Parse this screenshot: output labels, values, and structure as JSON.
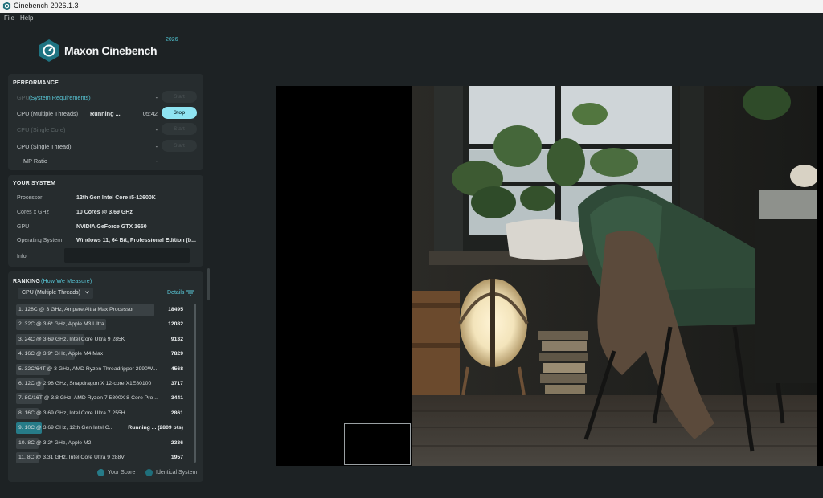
{
  "window": {
    "title": "Cinebench 2026.1.3"
  },
  "menu": {
    "file": "File",
    "help": "Help"
  },
  "logo": {
    "text": "Maxon Cinebench",
    "year": "2026"
  },
  "performance": {
    "title": "PERFORMANCE",
    "gpu": {
      "name": "GPU",
      "link": "(System Requirements)",
      "time": "-",
      "button": "Start"
    },
    "cpu_multi": {
      "name": "CPU (Multiple Threads)",
      "status": "Running ...",
      "time": "05:42",
      "button": "Stop"
    },
    "cpu_single_core": {
      "name": "CPU (Single Core)",
      "time": "-",
      "button": "Start"
    },
    "cpu_single_thread": {
      "name": "CPU (Single Thread)",
      "time": "-",
      "button": "Start"
    },
    "mp_ratio": {
      "name": "MP Ratio",
      "time": "-"
    }
  },
  "system": {
    "title": "YOUR SYSTEM",
    "rows": [
      {
        "label": "Processor",
        "value": "12th Gen Intel Core i5-12600K"
      },
      {
        "label": "Cores x GHz",
        "value": "10 Cores @ 3.69 GHz"
      },
      {
        "label": "GPU",
        "value": "NVIDIA GeForce GTX 1650"
      },
      {
        "label": "Operating System",
        "value": "Windows 11, 64 Bit, Professional Edition (b..."
      },
      {
        "label": "Info",
        "value": ""
      }
    ]
  },
  "ranking": {
    "title": "RANKING",
    "link": "(How We Measure)",
    "dropdown": "CPU (Multiple Threads)",
    "details": "Details",
    "max": 18495,
    "rows": [
      {
        "text": "1. 128C @ 3 GHz, Ampere Altra Max Processor",
        "score": "18495",
        "value": 18495
      },
      {
        "text": "2. 32C @ 3.6* GHz, Apple M3 Ultra",
        "score": "12082",
        "value": 12082
      },
      {
        "text": "3. 24C @ 3.69 GHz, Intel Core Ultra 9 285K",
        "score": "9132",
        "value": 9132
      },
      {
        "text": "4. 16C @ 3.9* GHz, Apple M4 Max",
        "score": "7829",
        "value": 7829
      },
      {
        "text": "5. 32C/64T @ 3 GHz, AMD Ryzen Threadripper 2990W...",
        "score": "4568",
        "value": 4568
      },
      {
        "text": "6. 12C @ 2.98 GHz, Snapdragon X 12-core X1E80100",
        "score": "3717",
        "value": 3717
      },
      {
        "text": "7. 8C/16T @ 3.8 GHz, AMD Ryzen 7 5800X 8-Core Pro...",
        "score": "3441",
        "value": 3441
      },
      {
        "text": "8. 16C @ 3.69 GHz, Intel Core Ultra 7 255H",
        "score": "2861",
        "value": 2861
      },
      {
        "text": "9. 10C @ 3.69 GHz, 12th Gen Intel C...",
        "score": "Running ... (2809 pts)",
        "value": 2809,
        "mine": true
      },
      {
        "text": "10. 8C @ 3.2* GHz, Apple M2",
        "score": "2336",
        "value": 2336
      },
      {
        "text": "11. 8C @ 3.31 GHz, Intel Core Ultra 9 288V",
        "score": "1957",
        "value": 1957
      }
    ],
    "legend": {
      "your_score": "Your Score",
      "identical": "Identical System"
    }
  },
  "colors": {
    "accent": "#59c8d8",
    "your_score": "#267b88",
    "identical": "#1f6f7b",
    "stop_button": "#8fe4f2"
  }
}
